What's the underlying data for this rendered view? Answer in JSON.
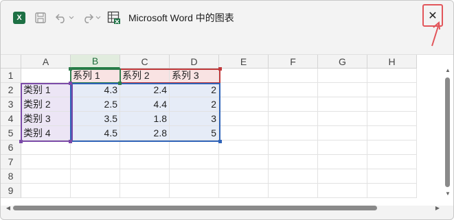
{
  "window": {
    "title": "Microsoft Word 中的图表",
    "close_label": "✕"
  },
  "toolbar": {
    "excel_icon": "excel-icon",
    "excel_letter": "X",
    "save_icon": "save-icon",
    "undo_icon": "undo-icon",
    "redo_icon": "redo-icon",
    "sheet_icon": "excel-sheet-icon"
  },
  "sheet": {
    "columns": [
      "A",
      "B",
      "C",
      "D",
      "E",
      "F",
      "G",
      "H"
    ],
    "rows": [
      "1",
      "2",
      "3",
      "4",
      "5",
      "6",
      "7",
      "8",
      "9"
    ],
    "header_row": [
      "",
      "系列 1",
      "系列 2",
      "系列 3"
    ],
    "data": [
      [
        "类别 1",
        "4.3",
        "2.4",
        "2"
      ],
      [
        "类别 2",
        "2.5",
        "4.4",
        "2"
      ],
      [
        "类别 3",
        "3.5",
        "1.8",
        "3"
      ],
      [
        "类别 4",
        "4.5",
        "2.8",
        "5"
      ]
    ],
    "selected_column": "B"
  },
  "colors": {
    "excel_green": "#1d7044",
    "range_purple": "#7b4aa8",
    "range_red": "#c0393b",
    "range_blue": "#2f63b8",
    "close_highlight": "#e2555a"
  }
}
